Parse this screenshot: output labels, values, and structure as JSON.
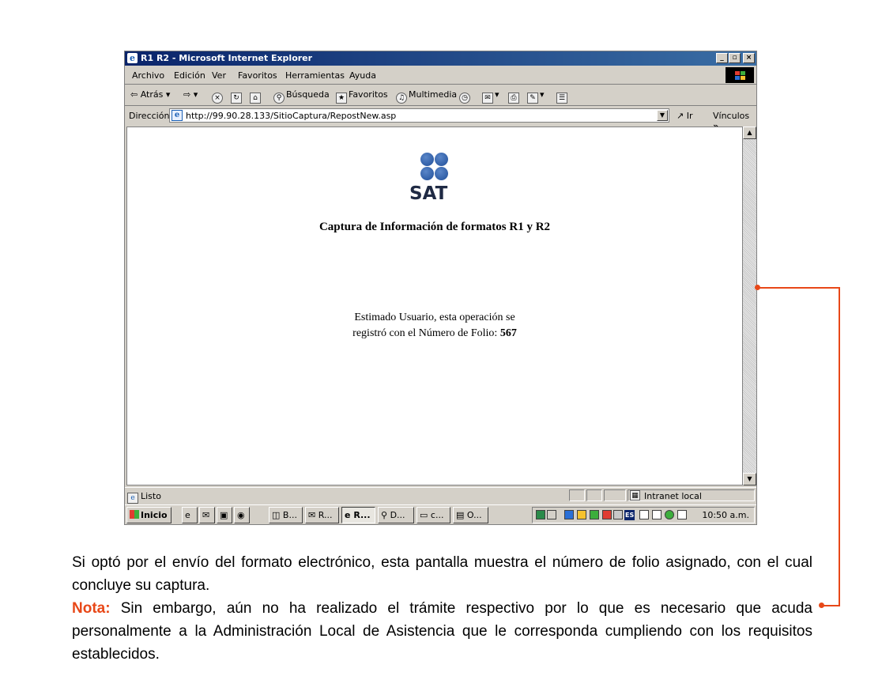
{
  "window": {
    "title": "R1 R2 - Microsoft Internet Explorer",
    "controls": [
      "_",
      "▫",
      "×"
    ]
  },
  "menu": [
    "Archivo",
    "Edición",
    "Ver",
    "Favoritos",
    "Herramientas",
    "Ayuda"
  ],
  "toolbar": {
    "back_label": "Atrás",
    "search_label": "Búsqueda",
    "favorites_label": "Favoritos",
    "multimedia_label": "Multimedia"
  },
  "address": {
    "label": "Dirección",
    "url": "http://99.90.28.133/SitioCaptura/RepostNew.asp",
    "go_label": "Ir",
    "links_label": "Vínculos"
  },
  "page": {
    "logo_text": "SAT",
    "title": "Captura de Información de formatos R1 y R2",
    "message_line1": "Estimado Usuario, esta operación se",
    "message_line2": "registró con el Número de Folio: ",
    "folio": "567"
  },
  "status": {
    "text": "Listo",
    "zone": "Intranet local"
  },
  "taskbar": {
    "start_label": "Inicio",
    "tasks": [
      "B...",
      "R...",
      "R...",
      "D...",
      "c...",
      "O..."
    ],
    "tray_lang": "ES",
    "clock": "10:50 a.m."
  },
  "description": {
    "paragraph": "Si optó por el envío del formato electrónico, esta pantalla muestra el número de folio asignado, con el cual concluye su captura.",
    "note_label": "Nota:",
    "note_text": " Sin embargo, aún no ha realizado el trámite respectivo por lo que es necesario que acuda personalmente a la Administración Local de Asistencia que le corresponda cumpliendo con los requisitos establecidos."
  },
  "colors": {
    "accent": "#e84818",
    "titlebar": "#0a246a",
    "sat_logo": "#1f4e99"
  }
}
